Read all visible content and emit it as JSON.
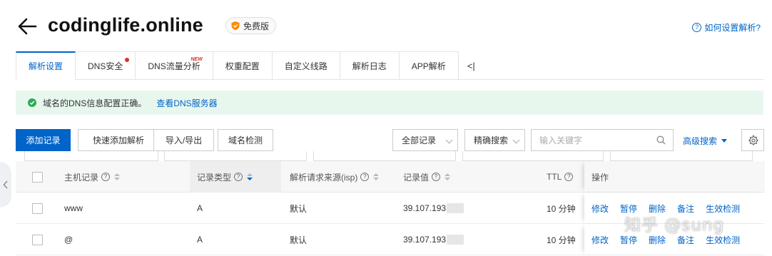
{
  "header": {
    "domain": "codinglife.online",
    "badge": "免费版",
    "help_link": "如何设置解析?"
  },
  "tabs": [
    {
      "label": "解析设置",
      "active": true
    },
    {
      "label": "DNS安全",
      "dot": true
    },
    {
      "label": "DNS流量分析",
      "tag": "NEW"
    },
    {
      "label": "权重配置"
    },
    {
      "label": "自定义线路"
    },
    {
      "label": "解析日志"
    },
    {
      "label": "APP解析"
    }
  ],
  "tabs_more": "<|",
  "alert": {
    "message": "域名的DNS信息配置正确。",
    "link": "查看DNS服务器"
  },
  "toolbar": {
    "add_record": "添加记录",
    "quick_add": "快速添加解析",
    "import_export": "导入/导出",
    "domain_check": "域名检测",
    "record_filter": "全部记录",
    "search_mode": "精确搜索",
    "search_placeholder": "输入关键字",
    "advanced_search": "高级搜索"
  },
  "table": {
    "columns": {
      "host": "主机记录",
      "type": "记录类型",
      "isp": "解析请求来源(isp)",
      "value": "记录值",
      "ttl": "TTL",
      "ops": "操作"
    },
    "rows": [
      {
        "host": "www",
        "type": "A",
        "isp": "默认",
        "value": "39.107.193",
        "ttl": "10 分钟"
      },
      {
        "host": "@",
        "type": "A",
        "isp": "默认",
        "value": "39.107.193",
        "ttl": "10 分钟"
      }
    ],
    "actions": [
      "修改",
      "暂停",
      "删除",
      "备注",
      "生效检测"
    ]
  },
  "watermark": "知乎 @sung",
  "colors": {
    "accent": "#0064c8",
    "success": "#2bab53",
    "alert_bg": "#e8f7ee",
    "danger": "#d93026"
  }
}
